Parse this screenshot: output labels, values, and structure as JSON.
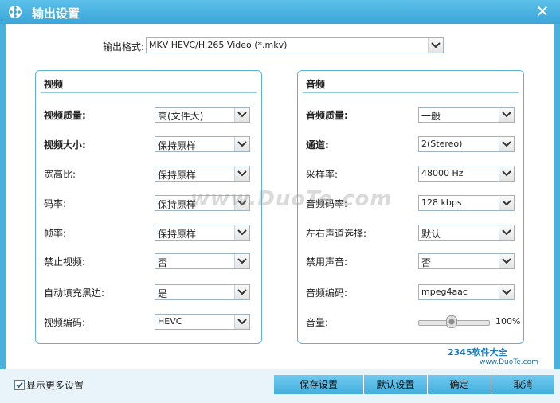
{
  "window": {
    "title": "输出设置",
    "close_glyph": "✕"
  },
  "format": {
    "label": "输出格式:",
    "value": "MKV HEVC/H.265 Video (*.mkv)"
  },
  "video": {
    "title": "视频",
    "rows": [
      {
        "label": "视频质量:",
        "value": "高(文件大)"
      },
      {
        "label": "视频大小:",
        "value": "保持原样"
      },
      {
        "label": "宽高比:",
        "value": "保持原样"
      },
      {
        "label": "码率:",
        "value": "保持原样"
      },
      {
        "label": "帧率:",
        "value": "保持原样"
      },
      {
        "label": "禁止视频:",
        "value": "否"
      },
      {
        "label": "自动填充黑边:",
        "value": "是"
      },
      {
        "label": "视频编码:",
        "value": "HEVC"
      }
    ]
  },
  "audio": {
    "title": "音频",
    "rows": [
      {
        "label": "音频质量:",
        "value": "一般"
      },
      {
        "label": "通道:",
        "value": "2(Stereo)"
      },
      {
        "label": "采样率:",
        "value": "48000 Hz"
      },
      {
        "label": "音频码率:",
        "value": "128 kbps"
      },
      {
        "label": "左右声道选择:",
        "value": "默认"
      },
      {
        "label": "禁用声音:",
        "value": "否"
      },
      {
        "label": "音频编码:",
        "value": "mpeg4aac"
      }
    ],
    "volume": {
      "label": "音量:",
      "value": "100%",
      "level": 0.5
    }
  },
  "footer": {
    "show_more": {
      "label": "显示更多设置",
      "checked": true
    },
    "buttons": {
      "save": "保存设置",
      "default": "默认设置",
      "ok": "确定",
      "cancel": "取消"
    }
  },
  "watermark": "www.DuoTe.com",
  "brand": {
    "name": "2345软件大全",
    "url": "www.DuoTe.com"
  }
}
